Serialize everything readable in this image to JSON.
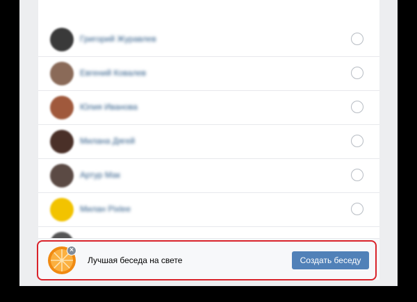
{
  "contacts": [
    {
      "name": "Григорий Журавлев",
      "avatar_color": "#3a3a3a"
    },
    {
      "name": "Евгений Ковалев",
      "avatar_color": "#8a6a58"
    },
    {
      "name": "Юлия Иванова",
      "avatar_color": "#a0593c"
    },
    {
      "name": "Милана Дягей",
      "avatar_color": "#4a3028"
    },
    {
      "name": "Артур Мак",
      "avatar_color": "#5b4a44"
    },
    {
      "name": "Милан Pixlee",
      "avatar_color": "#f2c300"
    }
  ],
  "chat_form": {
    "title_value": "Лучшая беседа на свете",
    "create_button_label": "Создать беседу",
    "remove_photo_label": "×",
    "chat_avatar_icon": "orange-slice-icon"
  },
  "colors": {
    "accent": "#5181b8",
    "highlight": "#d9222a",
    "link": "#2a5885"
  }
}
